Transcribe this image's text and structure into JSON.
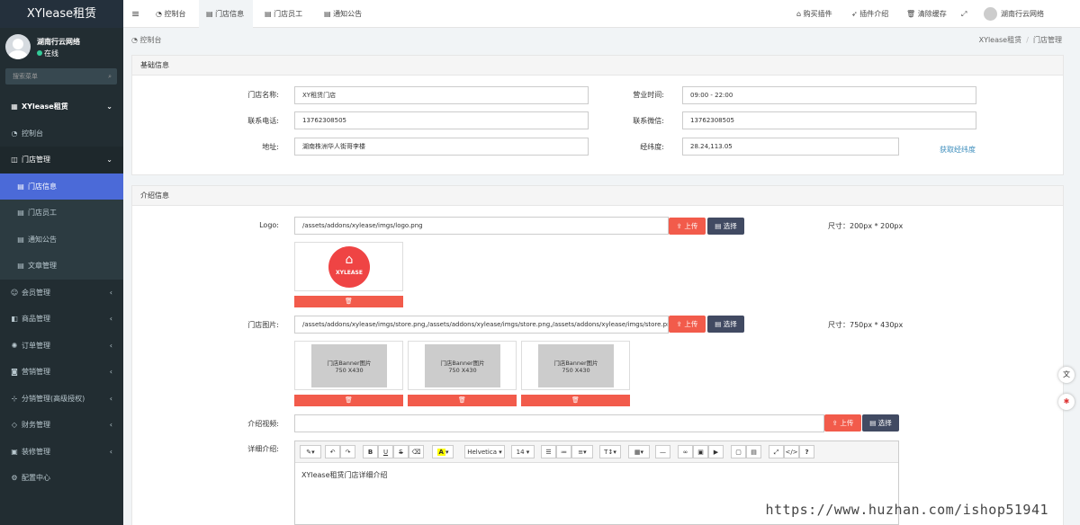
{
  "sidebar": {
    "brand": "XYlease租赁",
    "user_name": "湖南行云网络",
    "user_status": "在线",
    "search_placeholder": "搜索菜单",
    "items": [
      {
        "label": "XYlease租赁",
        "icon": "grid-icon",
        "arrow": "⌄"
      },
      {
        "label": "控制台",
        "icon": "dashboard-icon",
        "arrow": ""
      },
      {
        "label": "门店管理",
        "icon": "store-icon",
        "arrow": "⌄"
      },
      {
        "label": "门店信息",
        "icon": "list-icon",
        "arrow": ""
      },
      {
        "label": "门店员工",
        "icon": "list-icon",
        "arrow": ""
      },
      {
        "label": "通知公告",
        "icon": "list-icon",
        "arrow": ""
      },
      {
        "label": "文章管理",
        "icon": "list-icon",
        "arrow": ""
      },
      {
        "label": "会员管理",
        "icon": "user-icon",
        "arrow": "‹"
      },
      {
        "label": "商品管理",
        "icon": "goods-icon",
        "arrow": "‹"
      },
      {
        "label": "订单管理",
        "icon": "order-icon",
        "arrow": "‹"
      },
      {
        "label": "营销管理",
        "icon": "marketing-icon",
        "arrow": "‹"
      },
      {
        "label": "分销管理(高级授权)",
        "icon": "share-icon",
        "arrow": "‹"
      },
      {
        "label": "财务管理",
        "icon": "finance-icon",
        "arrow": "‹"
      },
      {
        "label": "装修管理",
        "icon": "decor-icon",
        "arrow": "‹"
      },
      {
        "label": "配置中心",
        "icon": "gear-icon",
        "arrow": ""
      }
    ]
  },
  "topbar": {
    "menu_toggle": "≡",
    "tabs": [
      "控制台",
      "门店信息",
      "门店员工",
      "通知公告"
    ],
    "right": [
      "购买插件",
      "插件介绍",
      "清除缓存"
    ],
    "user": "湖南行云网络"
  },
  "breadcrumb": {
    "left": "控制台",
    "path1": "XYlease租赁",
    "sep": "/",
    "path2": "门店管理"
  },
  "basic": {
    "title": "基础信息",
    "name_label": "门店名称:",
    "name_value": "XY租赁门店",
    "hours_label": "营业时间:",
    "hours_value": "09:00 - 22:00",
    "phone_label": "联系电话:",
    "phone_value": "13762308505",
    "wechat_label": "联系微信:",
    "wechat_value": "13762308505",
    "addr_label": "地址:",
    "addr_value": "湖南株洲华人街哥李楼",
    "geo_label": "经纬度:",
    "geo_value": "28.24,113.05",
    "geo_link": "获取经纬度"
  },
  "intro": {
    "title": "介绍信息",
    "logo_label": "Logo:",
    "logo_value": "/assets/addons/xylease/imgs/logo.png",
    "logo_text": "XYLEASE",
    "upload": "上传",
    "choose": "选择",
    "logo_size": "尺寸：200px * 200px",
    "store_img_label": "门店图片:",
    "store_img_value": "/assets/addons/xylease/imgs/store.png,/assets/addons/xylease/imgs/store.png,/assets/addons/xylease/imgs/store.png",
    "store_size": "尺寸：750px * 430px",
    "banner_text": "门店Banner图片",
    "banner_dim": "750 X430",
    "video_label": "介绍视频:",
    "detail_label": "详细介绍:",
    "editor_font": "Helvetica",
    "editor_size": "14",
    "editor_content": "XYlease租赁门店详细介绍"
  },
  "watermark": "https://www.huzhan.com/ishop51941"
}
